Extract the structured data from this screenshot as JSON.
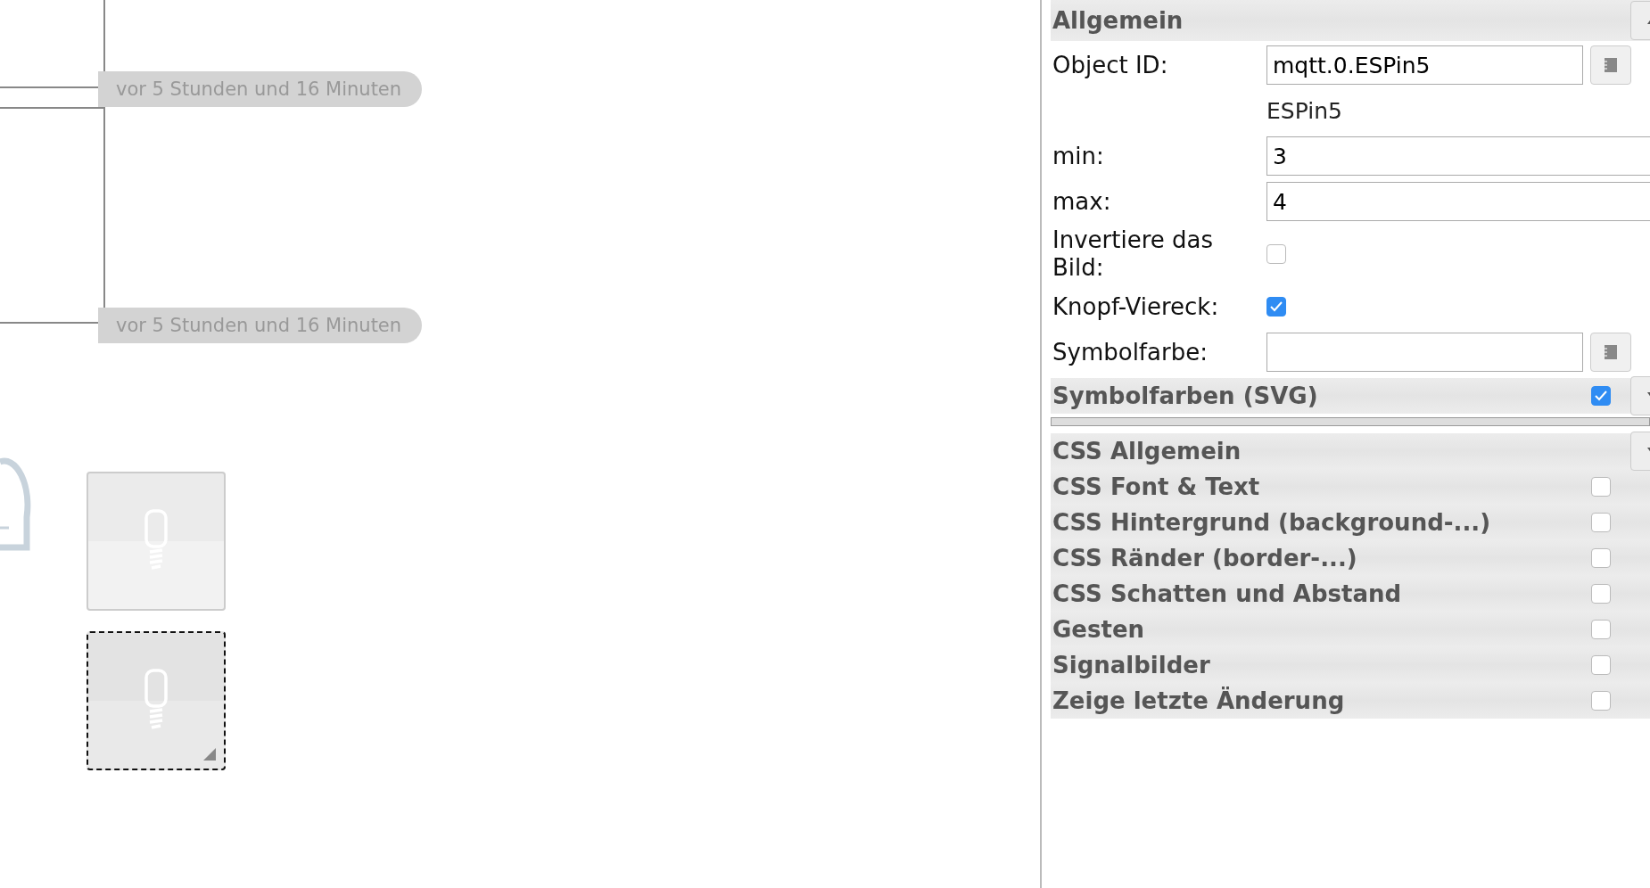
{
  "canvas": {
    "timestamps": [
      {
        "text": "vor 5 Stunden und 16 Minuten"
      },
      {
        "text": "vor 5 Stunden und 16 Minuten"
      }
    ],
    "tiles": [
      {
        "selected": false
      },
      {
        "selected": true
      }
    ]
  },
  "panel": {
    "sections": [
      {
        "kind": "section",
        "title": "Allgemein",
        "expanded": true,
        "fields": [
          {
            "kind": "picker",
            "label": "Object ID:",
            "value": "mqtt.0.ESPin5"
          },
          {
            "kind": "note",
            "text": "ESPin5"
          },
          {
            "kind": "input",
            "label": "min:",
            "value": "3"
          },
          {
            "kind": "input",
            "label": "max:",
            "value": "4"
          },
          {
            "kind": "checkbox",
            "label": "Invertiere das Bild:",
            "checked": false
          },
          {
            "kind": "checkbox",
            "label": "Knopf-Viereck:",
            "checked": true
          },
          {
            "kind": "picker",
            "label": "Symbolfarbe:"
          }
        ]
      },
      {
        "kind": "group",
        "title": "Symbolfarben (SVG)",
        "checked": true,
        "expanded": false
      },
      {
        "kind": "separator"
      },
      {
        "kind": "group",
        "title": "CSS Allgemein",
        "expanded": false
      },
      {
        "kind": "group",
        "title": "CSS Font & Text",
        "checked": false
      },
      {
        "kind": "group",
        "title": "CSS Hintergrund (background-...)",
        "checked": false
      },
      {
        "kind": "group",
        "title": "CSS Ränder (border-...)",
        "checked": false
      },
      {
        "kind": "group",
        "title": "CSS Schatten und Abstand",
        "checked": false
      },
      {
        "kind": "group",
        "title": "Gesten",
        "checked": false
      },
      {
        "kind": "group",
        "title": "Signalbilder",
        "checked": false
      },
      {
        "kind": "group",
        "title": "Zeige letzte Änderung",
        "checked": false
      }
    ]
  }
}
